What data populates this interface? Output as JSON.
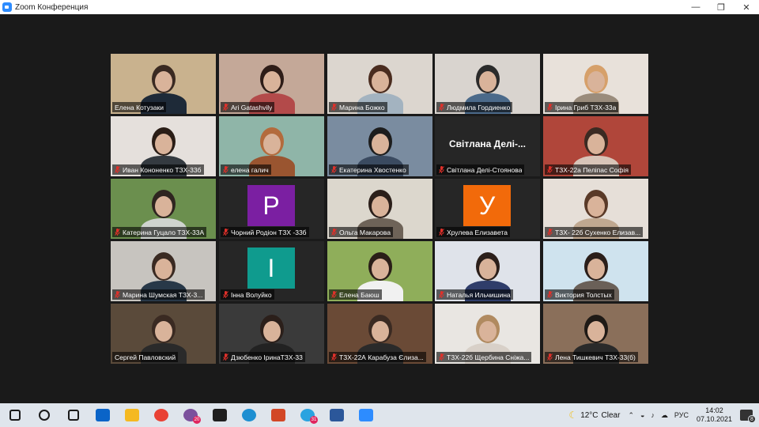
{
  "window": {
    "title": "Zoom Конференция",
    "minimize_glyph": "—",
    "restore_glyph": "❐",
    "close_glyph": "✕"
  },
  "participants": [
    {
      "name": "Елена Котузаки",
      "muted": false
    },
    {
      "name": "Ari Gatashvily",
      "muted": true
    },
    {
      "name": "Марина Божко",
      "muted": true
    },
    {
      "name": "Людмила Гордиенко",
      "muted": true
    },
    {
      "name": "Ірина Гриб ТЗХ-33а",
      "muted": true
    },
    {
      "name": "Иван Кононенко ТЗХ-33б",
      "muted": true
    },
    {
      "name": "елена галич",
      "muted": true
    },
    {
      "name": "Екатерина Хвостенко",
      "muted": true
    },
    {
      "name": "Світлана Делі-Стоянова",
      "muted": true,
      "display": "Світлана  Делі-..."
    },
    {
      "name": "ТЗХ-22а Пеліпас Софія",
      "muted": true
    },
    {
      "name": "Катерина Гуцало ТЗХ-33А",
      "muted": true
    },
    {
      "name": "Чорний Родіон ТЗХ -33б",
      "muted": true,
      "avatar": "P",
      "avatar_color": "#7b1fa2"
    },
    {
      "name": "Ольга Макарова",
      "muted": true
    },
    {
      "name": "Хрулева Елизавета",
      "muted": true,
      "avatar": "У",
      "avatar_color": "#f26a0a"
    },
    {
      "name": "ТЗХ- 22б Сухенко Елизав...",
      "muted": true
    },
    {
      "name": "Марина Шумская ТЗХ-3...",
      "muted": true
    },
    {
      "name": "Інна Волуйко",
      "muted": true,
      "avatar": "І",
      "avatar_color": "#0f9b8e"
    },
    {
      "name": "Елена Баюш",
      "muted": true
    },
    {
      "name": "Наталья Ильчишина",
      "muted": true
    },
    {
      "name": "Виктория Толстых",
      "muted": true
    },
    {
      "name": "Сергей Павловский",
      "muted": false
    },
    {
      "name": "Дзюбенко ІринаТЗХ-33",
      "muted": true
    },
    {
      "name": "ТЗХ-22А Карабуза Єлиза...",
      "muted": true
    },
    {
      "name": "ТЗХ-22б Щербина Сніжа...",
      "muted": true
    },
    {
      "name": "Лена Тишкевич ТЗХ-33(б)",
      "muted": true
    }
  ],
  "taskbar": {
    "apps": [
      {
        "icon": "windows-start-icon",
        "color": "#1a1a1a"
      },
      {
        "icon": "search-icon",
        "color": "#1a1a1a"
      },
      {
        "icon": "task-view-icon",
        "color": "#1a1a1a"
      },
      {
        "icon": "mail-icon",
        "color": "#0a64c8"
      },
      {
        "icon": "file-explorer-icon",
        "color": "#f5b921"
      },
      {
        "icon": "chrome-icon",
        "color": "#e94235"
      },
      {
        "icon": "viber-icon",
        "color": "#7b519d",
        "badge": "20"
      },
      {
        "icon": "sticky-notes-icon",
        "color": "#1f1f1f"
      },
      {
        "icon": "edge-icon",
        "color": "#1e8fd1"
      },
      {
        "icon": "powerpoint-icon",
        "color": "#d24726"
      },
      {
        "icon": "telegram-icon",
        "color": "#2aa3e0",
        "badge": "31"
      },
      {
        "icon": "word-icon",
        "color": "#2b579a"
      },
      {
        "icon": "zoom-icon",
        "color": "#2d8cff"
      }
    ],
    "weather_temp": "12°C",
    "weather_text": "Clear",
    "language": "РУС",
    "time": "14:02",
    "date": "07.10.2021",
    "notification_count": "8"
  }
}
